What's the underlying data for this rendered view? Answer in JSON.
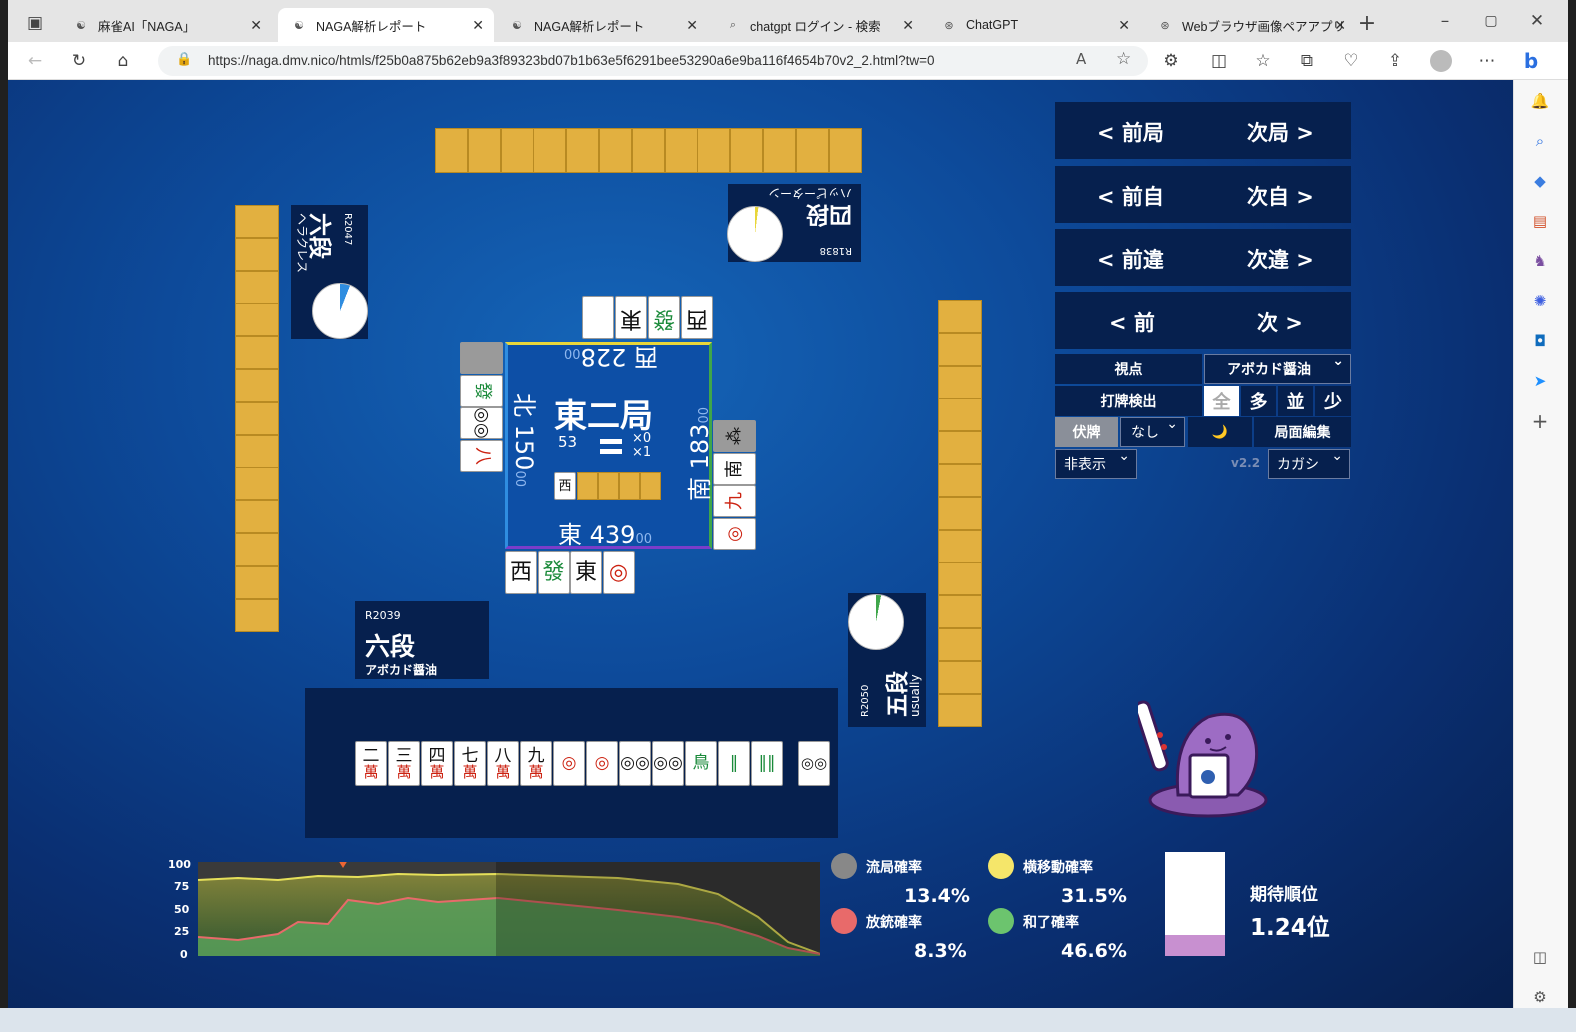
{
  "tabs": [
    {
      "title": "麻雀AI「NAGA」"
    },
    {
      "title": "NAGA解析レポート"
    },
    {
      "title": "NAGA解析レポート"
    },
    {
      "title": "chatgpt ログイン - 検索"
    },
    {
      "title": "ChatGPT"
    },
    {
      "title": "Webブラウザ画像ペアアプリ開発"
    }
  ],
  "url": "https://naga.dmv.nico/htmls/f25b0a875b62eb9a3f89323bd07b1b63e5f6291bee53290a6e9ba116f4654b70v2_2.html?tw=0",
  "nav": {
    "prev_round": "< 前局",
    "next_round": "次局 >",
    "prev_self": "< 前自",
    "next_self": "次自 >",
    "prev_diff": "< 前違",
    "next_diff": "次違 >",
    "prev": "< 前",
    "next": "次 >"
  },
  "controls": {
    "viewpoint_label": "視点",
    "viewpoint_value": "アボカド醤油",
    "detect_label": "打牌検出",
    "detect_options": [
      "全",
      "多",
      "並",
      "少"
    ],
    "fuse_label": "伏牌",
    "fuse_value": "なし",
    "moon": "🌙",
    "edit_label": "局面編集",
    "hide_value": "非表示",
    "version": "v2.2",
    "name_value": "カガシ"
  },
  "players": {
    "self": {
      "rating": "R2039",
      "dan": "六段",
      "name": "アボカド醤油"
    },
    "left": {
      "rating": "R2047",
      "dan": "六段",
      "name": "ヘラクレス"
    },
    "top": {
      "rating": "R1838",
      "dan": "四段",
      "name": "ハッピーターン"
    },
    "right": {
      "rating": "R2050",
      "dan": "五段",
      "name": "usually"
    }
  },
  "center": {
    "round": "東二局",
    "tiles_left": "53",
    "honba": "×0",
    "riichi": "×1",
    "east": "東",
    "east_score": "439",
    "north": "北",
    "north_score": "150",
    "south": "南",
    "south_score": "183",
    "west": "西",
    "west_score": "228",
    "zeros": "00",
    "dora_indicator": "西"
  },
  "hand": [
    {
      "t": "二",
      "s": "萬",
      "c": "red"
    },
    {
      "t": "三",
      "s": "萬",
      "c": "red"
    },
    {
      "t": "四",
      "s": "萬",
      "c": "red"
    },
    {
      "t": "七",
      "s": "萬",
      "c": "red"
    },
    {
      "t": "八",
      "s": "萬",
      "c": "red"
    },
    {
      "t": "九",
      "s": "萬",
      "c": "red"
    },
    {
      "t": "◎",
      "s": "",
      "c": "red"
    },
    {
      "t": "◎",
      "s": "",
      "c": "red"
    },
    {
      "t": "◎◎",
      "s": "",
      "c": ""
    },
    {
      "t": "◎◎",
      "s": "",
      "c": ""
    },
    {
      "t": "鳥",
      "s": "",
      "c": "green"
    },
    {
      "t": "‖",
      "s": "",
      "c": "green"
    },
    {
      "t": "‖‖",
      "s": "",
      "c": "green"
    }
  ],
  "hand_draw": {
    "t": "◎◎",
    "s": "",
    "c": ""
  },
  "discards": {
    "self": [
      {
        "t": "西",
        "c": ""
      },
      {
        "t": "發",
        "c": "green"
      },
      {
        "t": "東",
        "c": ""
      },
      {
        "t": "◎",
        "c": "red"
      }
    ],
    "top": [
      {
        "t": "",
        "c": ""
      },
      {
        "t": "東",
        "c": ""
      },
      {
        "t": "發",
        "c": "green"
      },
      {
        "t": "西",
        "c": ""
      }
    ],
    "left": [
      {
        "t": "",
        "c": "gray"
      },
      {
        "t": "發",
        "c": "green"
      },
      {
        "t": "◎◎",
        "c": ""
      },
      {
        "t": "八",
        "c": "red"
      }
    ],
    "right": [
      {
        "t": "⁂",
        "c": "gray"
      },
      {
        "t": "南",
        "c": ""
      },
      {
        "t": "九",
        "c": "red"
      },
      {
        "t": "◎",
        "c": "red"
      }
    ]
  },
  "graph": {
    "y_ticks": [
      "100",
      "75",
      "50",
      "25",
      "0"
    ]
  },
  "stats": {
    "ryukyoku_label": "流局確率",
    "ryukyoku_value": "13.4%",
    "yoko_label": "横移動確率",
    "yoko_value": "31.5%",
    "houju_label": "放銃確率",
    "houju_value": "8.3%",
    "hora_label": "和了確率",
    "hora_value": "46.6%",
    "expected_label": "期待順位",
    "expected_value": "1.24位",
    "expected_fill": 0.2
  },
  "colors": {
    "ryukyoku": "#888888",
    "yoko": "#f5e66a",
    "houju": "#e86a6a",
    "hora": "#6cc46e",
    "rank_fill": "#c890d0"
  }
}
